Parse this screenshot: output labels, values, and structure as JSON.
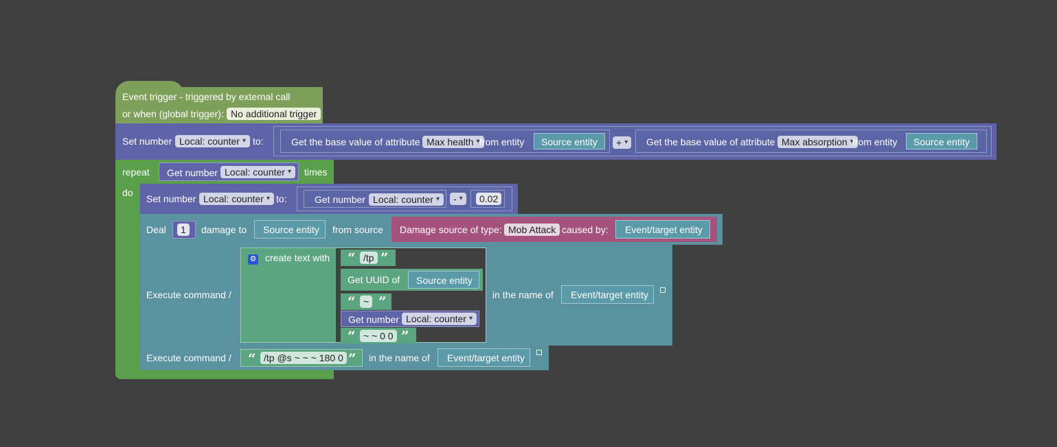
{
  "trigger": {
    "line1": "Event trigger - triggered by external call",
    "line2_label": "or when (global trigger):",
    "global_trigger": "No additional trigger"
  },
  "set1": {
    "label": "Set number",
    "var": "Local: counter",
    "to": "to:",
    "attr_a": {
      "label": "Get the base value of attribute",
      "attribute": "Max health",
      "from": "from entity",
      "entity": "Source entity"
    },
    "op": "+",
    "attr_b": {
      "label": "Get the base value of attribute",
      "attribute": "Max absorption",
      "from": "from entity",
      "entity": "Source entity"
    }
  },
  "repeat": {
    "label": "repeat",
    "get_label": "Get number",
    "var": "Local: counter",
    "times": "times",
    "do": "do"
  },
  "set2": {
    "label": "Set number",
    "var": "Local: counter",
    "to": "to:",
    "get_label": "Get number",
    "get_var": "Local: counter",
    "op": "-",
    "value": "0.02"
  },
  "deal": {
    "label": "Deal",
    "amount": "1",
    "damage_to": "damage to",
    "target": "Source entity",
    "from_source": "from source",
    "src_label": "Damage source of type:",
    "src_type": "Mob Attack",
    "caused_by": "caused by:",
    "causer": "Event/target entity"
  },
  "exec1": {
    "label": "Execute command /",
    "create_text": "create text with",
    "t1": "/tp",
    "uuid_label": "Get UUID of",
    "uuid_entity": "Source entity",
    "t2": "~",
    "getnum_label": "Get number",
    "getnum_var": "Local: counter",
    "t3": "~ ~ 0 0",
    "in_name": "in the name of",
    "entity": "Event/target entity"
  },
  "exec2": {
    "label": "Execute command /",
    "text": "/tp @s ~ ~ ~ 180 0",
    "in_name": "in the name of",
    "entity": "Event/target entity"
  },
  "colors": {
    "background": "#404040",
    "trigger": "#7ea05a",
    "loop": "#5aa04c",
    "set_number": "#5f64a8",
    "command": "#5a92a0",
    "text": "#5ba580",
    "damage_source": "#a5527f",
    "entity": "#5b9aa8"
  },
  "icons": {
    "mutator": "gear-icon",
    "collapse": "collapse-icon",
    "quote_open": "“",
    "quote_close": "”"
  }
}
